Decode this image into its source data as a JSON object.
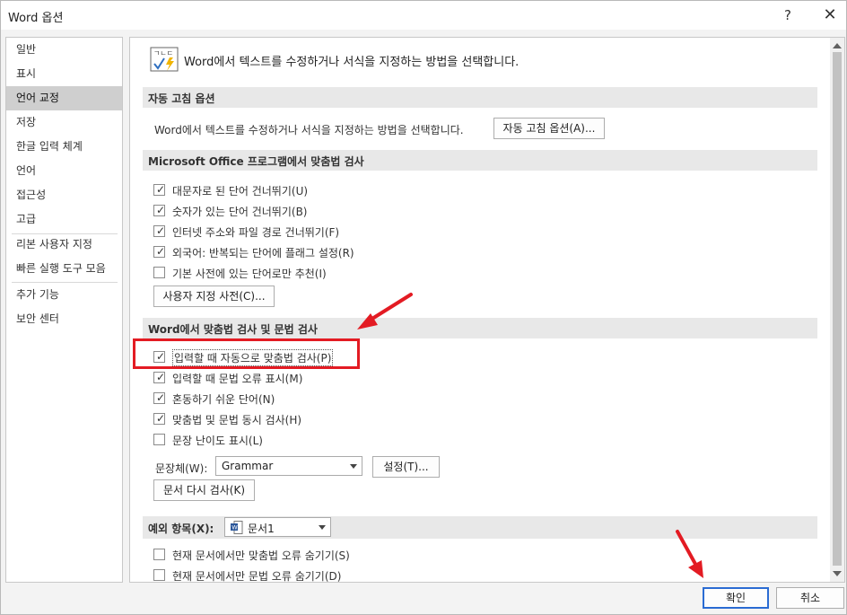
{
  "window": {
    "title": "Word 옵션",
    "help": "?",
    "close": "✕"
  },
  "sidebar": {
    "items": [
      {
        "label": "일반"
      },
      {
        "label": "표시"
      },
      {
        "label": "언어 교정",
        "active": true
      },
      {
        "label": "저장"
      },
      {
        "label": "한글 입력 체계"
      },
      {
        "label": "언어"
      },
      {
        "label": "접근성"
      },
      {
        "label": "고급"
      },
      {
        "label": "리본 사용자 지정"
      },
      {
        "label": "빠른 실행 도구 모음"
      },
      {
        "label": "추가 기능"
      },
      {
        "label": "보안 센터"
      }
    ]
  },
  "content": {
    "heading": "Word에서 텍스트를 수정하거나 서식을 지정하는 방법을 선택합니다.",
    "autocorrect": {
      "section": "자동 고침 옵션",
      "description": "Word에서 텍스트를 수정하거나 서식을 지정하는 방법을 선택합니다.",
      "button": "자동 고침 옵션(A)..."
    },
    "office_spelling": {
      "section": "Microsoft Office 프로그램에서 맞춤법 검사",
      "options": [
        {
          "label": "대문자로 된 단어 건너뛰기(U)",
          "checked": true
        },
        {
          "label": "숫자가 있는 단어 건너뛰기(B)",
          "checked": true
        },
        {
          "label": "인터넷 주소와 파일 경로 건너뛰기(F)",
          "checked": true
        },
        {
          "label": "외국어: 반복되는 단어에 플래그 설정(R)",
          "checked": true
        },
        {
          "label": "기본 사전에 있는 단어로만 추천(I)",
          "checked": false
        }
      ],
      "dict_button": "사용자 지정 사전(C)..."
    },
    "word_spelling": {
      "section": "Word에서 맞춤법 검사 및 문법 검사",
      "options": [
        {
          "label": "입력할 때 자동으로 맞춤법 검사(P)",
          "checked": true
        },
        {
          "label": "입력할 때 문법 오류 표시(M)",
          "checked": true
        },
        {
          "label": "혼동하기 쉬운 단어(N)",
          "checked": true
        },
        {
          "label": "맞춤법 및 문법 동시 검사(H)",
          "checked": true
        },
        {
          "label": "문장 난이도 표시(L)",
          "checked": false
        }
      ],
      "style_label": "문장체(W):",
      "style_value": "Grammar",
      "settings_button": "설정(T)...",
      "recheck_button": "문서 다시 검사(K)"
    },
    "exceptions": {
      "label": "예외 항목(X):",
      "doc_value": "문서1",
      "options": [
        {
          "label": "현재 문서에서만 맞춤법 오류 숨기기(S)",
          "checked": false
        },
        {
          "label": "현재 문서에서만 문법 오류 숨기기(D)",
          "checked": false
        }
      ]
    }
  },
  "footer": {
    "ok": "확인",
    "cancel": "취소"
  },
  "colors": {
    "highlight": "#e31b23",
    "ok_border": "#2b6cd3"
  }
}
